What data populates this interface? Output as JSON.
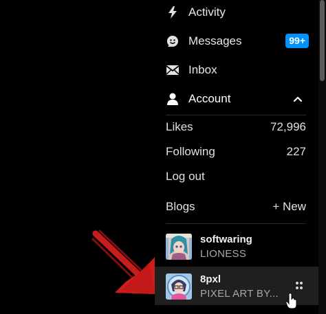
{
  "nav": {
    "activity": "Activity",
    "messages": "Messages",
    "messages_badge": "99+",
    "inbox": "Inbox",
    "account": "Account"
  },
  "account": {
    "likes_label": "Likes",
    "likes_value": "72,996",
    "following_label": "Following",
    "following_value": "227",
    "logout_label": "Log out"
  },
  "blogs": {
    "header_label": "Blogs",
    "new_label": "+ New",
    "items": [
      {
        "name": "softwaring",
        "title": "LIONESS",
        "selected": false
      },
      {
        "name": "8pxl",
        "title": "PIXEL ART BY...",
        "selected": true
      }
    ]
  },
  "colors": {
    "background": "#000000",
    "badge": "#0093ff",
    "selected_row": "#1f1f1f",
    "arrow": "#d8201f"
  },
  "icons": {
    "activity": "lightning-bolt-icon",
    "messages": "chat-bubble-smile-icon",
    "inbox": "envelope-icon",
    "account": "person-icon",
    "collapse": "chevron-up-icon",
    "drag": "grip-dots-icon",
    "pointer": "hand-cursor-icon",
    "annotation": "red-arrow-icon"
  }
}
